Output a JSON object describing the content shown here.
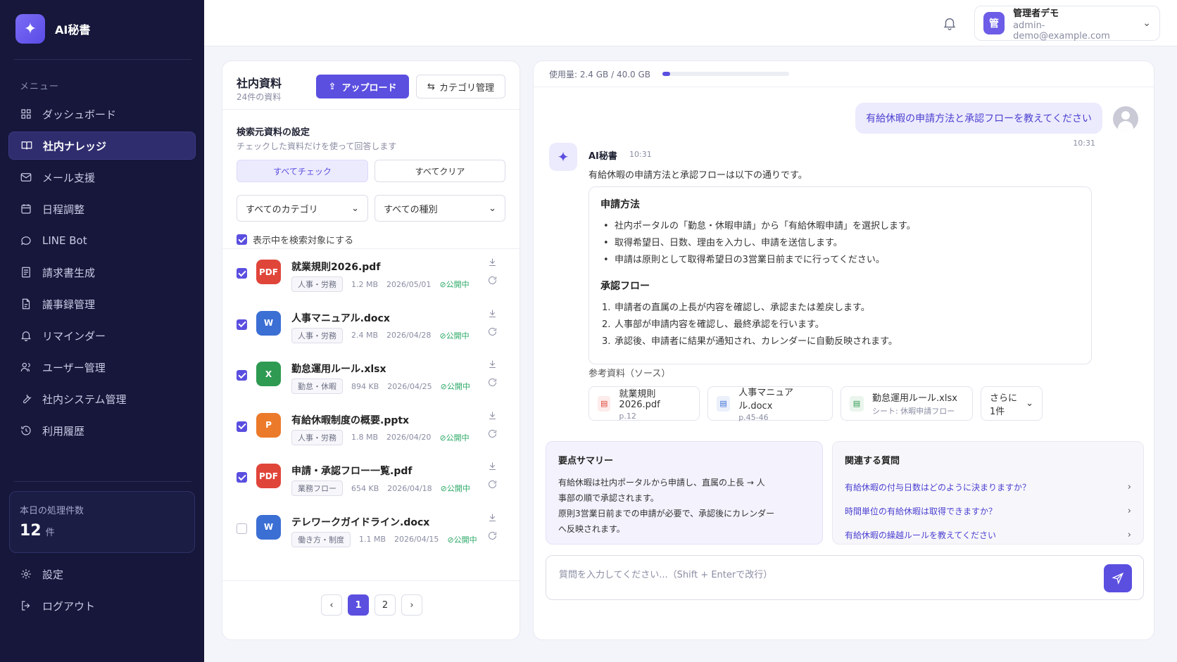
{
  "app": {
    "name": "AI秘書",
    "logo_icon": "sparkle-icon",
    "accent": "#5b4fe0"
  },
  "sidebar": {
    "menu_label": "メニュー",
    "items": [
      {
        "label": "ダッシュボード",
        "icon": "grid-icon",
        "active": false
      },
      {
        "label": "社内ナレッジ",
        "icon": "book-icon",
        "active": true
      },
      {
        "label": "メール支援",
        "icon": "mail-icon",
        "active": false
      },
      {
        "label": "日程調整",
        "icon": "calendar-icon",
        "active": false
      },
      {
        "label": "LINE Bot",
        "icon": "chat-bubble-icon",
        "active": false
      },
      {
        "label": "請求書生成",
        "icon": "invoice-icon",
        "active": false
      },
      {
        "label": "議事録管理",
        "icon": "document-icon",
        "active": false
      },
      {
        "label": "リマインダー",
        "icon": "bell-icon",
        "active": false
      },
      {
        "label": "ユーザー管理",
        "icon": "users-icon",
        "active": false
      },
      {
        "label": "社内システム管理",
        "icon": "wrench-icon",
        "active": false
      },
      {
        "label": "利用履歴",
        "icon": "history-icon",
        "active": false
      }
    ],
    "stat": {
      "label": "本日の処理件数",
      "value": "12",
      "unit": "件"
    },
    "bottom": [
      {
        "label": "設定",
        "icon": "gear-icon"
      },
      {
        "label": "ログアウト",
        "icon": "logout-icon"
      }
    ]
  },
  "topbar": {
    "user": {
      "avatar_text": "管",
      "name": "管理者デモ",
      "email": "admin-demo@example.com"
    }
  },
  "library": {
    "title": "社内資料",
    "subtitle": "24件の資料",
    "upload_label": "アップロード",
    "category_label": "カテゴリ管理",
    "source_title": "検索元資料の設定",
    "source_sub": "チェックした資料だけを使って回答します",
    "check_all": "すべてチェック",
    "clear_all": "すべてクリア",
    "category_select": "すべてのカテゴリ",
    "type_select": "すべての種別",
    "show_check_label": "表示中を検索対象にする",
    "files": [
      {
        "name": "就業規則2026.pdf",
        "type": "PDF",
        "color": "#e0453a",
        "tag": "人事・労務",
        "size": "1.2 MB",
        "date": "2026/05/01",
        "status": "公開中",
        "checked": true
      },
      {
        "name": "人事マニュアル.docx",
        "type": "W",
        "color": "#3b6fd4",
        "tag": "人事・労務",
        "size": "2.4 MB",
        "date": "2026/04/28",
        "status": "公開中",
        "checked": true
      },
      {
        "name": "勤怠運用ルール.xlsx",
        "type": "X",
        "color": "#2e9a52",
        "tag": "勤怠・休暇",
        "size": "894 KB",
        "date": "2026/04/25",
        "status": "公開中",
        "checked": true
      },
      {
        "name": "有給休暇制度の概要.pptx",
        "type": "P",
        "color": "#ec7a2b",
        "tag": "人事・労務",
        "size": "1.8 MB",
        "date": "2026/04/20",
        "status": "公開中",
        "checked": true
      },
      {
        "name": "申請・承認フロー一覧.pdf",
        "type": "PDF",
        "color": "#e0453a",
        "tag": "業務フロー",
        "size": "654 KB",
        "date": "2026/04/18",
        "status": "公開中",
        "checked": true
      },
      {
        "name": "テレワークガイドライン.docx",
        "type": "W",
        "color": "#3b6fd4",
        "tag": "働き方・制度",
        "size": "1.1 MB",
        "date": "2026/04/15",
        "status": "公開中",
        "checked": false
      }
    ],
    "pages": [
      "1",
      "2"
    ],
    "current_page": "1"
  },
  "chat": {
    "usage_label": "使用量: 2.4 GB / 40.0 GB",
    "usage_fraction": 0.06,
    "user_message": "有給休暇の申請方法と承認フローを教えてください",
    "user_time": "10:31",
    "ai_name": "AI秘書",
    "ai_time": "10:31",
    "ai_intro": "有給休暇の申請方法と承認フローは以下の通りです。",
    "section1_title": "申請方法",
    "section1_items": [
      "社内ポータルの「勤怠・休暇申請」から「有給休暇申請」を選択します。",
      "取得希望日、日数、理由を入力し、申請を送信します。",
      "申請は原則として取得希望日の3営業日前までに行ってください。"
    ],
    "section2_title": "承認フロー",
    "section2_items": [
      "申請者の直属の上長が内容を確認し、承認または差戻します。",
      "人事部が申請内容を確認し、最終承認を行います。",
      "承認後、申請者に結果が通知され、カレンダーに自動反映されます。"
    ],
    "ref_label": "参考資料（ソース）",
    "refs": [
      {
        "name": "就業規則2026.pdf",
        "sub": "p.12",
        "color": "#e0453a"
      },
      {
        "name": "人事マニュアル.docx",
        "sub": "p.45-46",
        "color": "#3b6fd4"
      },
      {
        "name": "勤怠運用ルール.xlsx",
        "sub": "シート: 休暇申請フロー",
        "color": "#2e9a52"
      }
    ],
    "ref_more": "さらに1件",
    "summary_title": "要点サマリー",
    "summary_lines": [
      "有給休暇は社内ポータルから申請し、直属の上長 → 人",
      "事部の順で承認されます。",
      "原則3営業日前までの申請が必要で、承認後にカレンダー",
      "へ反映されます。"
    ],
    "related_title": "関連する質問",
    "related": [
      "有給休暇の付与日数はどのように決まりますか？",
      "時間単位の有給休暇は取得できますか？",
      "有給休暇の繰越ルールを教えてください"
    ],
    "input_placeholder": "質問を入力してください...（Shift + Enterで改行）"
  }
}
